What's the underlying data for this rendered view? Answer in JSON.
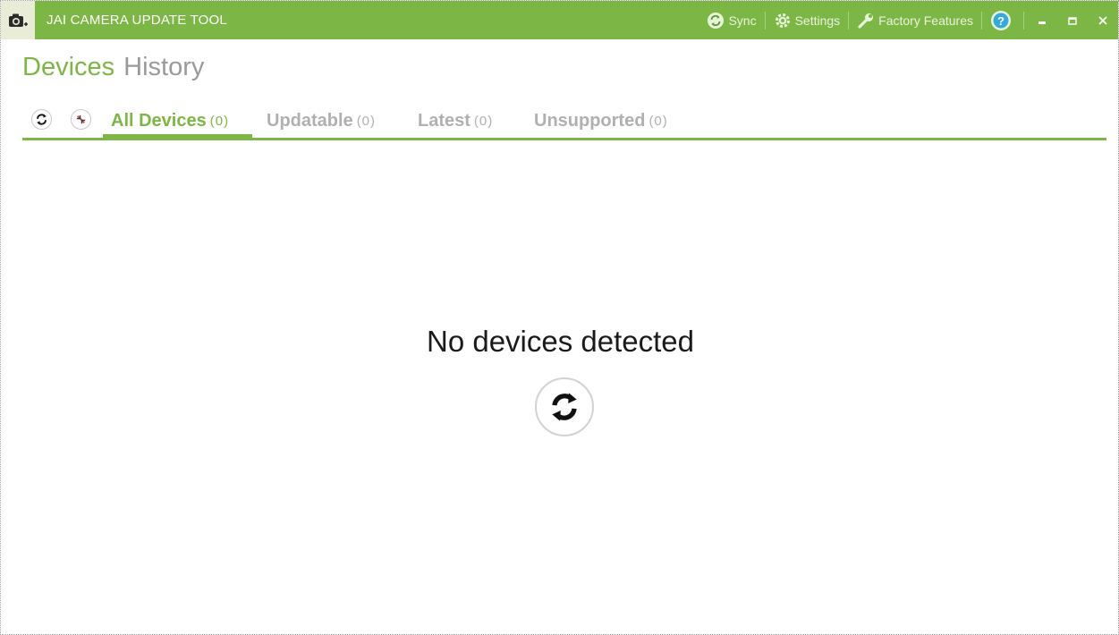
{
  "window": {
    "title": "JAI CAMERA UPDATE TOOL",
    "accent_color": "#7cb644",
    "icon": "camera-icon"
  },
  "titlebar": {
    "sync_label": "Sync",
    "settings_label": "Settings",
    "factory_label": "Factory Features",
    "help_icon": "help-icon",
    "minimize_icon": "minimize-icon",
    "maximize_icon": "maximize-icon",
    "close_icon": "close-icon"
  },
  "nav": {
    "devices_label": "Devices",
    "history_label": "History"
  },
  "tabs": [
    {
      "label": "All Devices",
      "count": "(0)"
    },
    {
      "label": "Updatable",
      "count": "(0)"
    },
    {
      "label": "Latest",
      "count": "(0)"
    },
    {
      "label": "Unsupported",
      "count": "(0)"
    }
  ],
  "toolbar": {
    "refresh_icon": "refresh-icon",
    "disconnect_icon": "disconnect-icon"
  },
  "empty_state": {
    "message": "No devices detected",
    "refresh_icon": "refresh-icon"
  }
}
